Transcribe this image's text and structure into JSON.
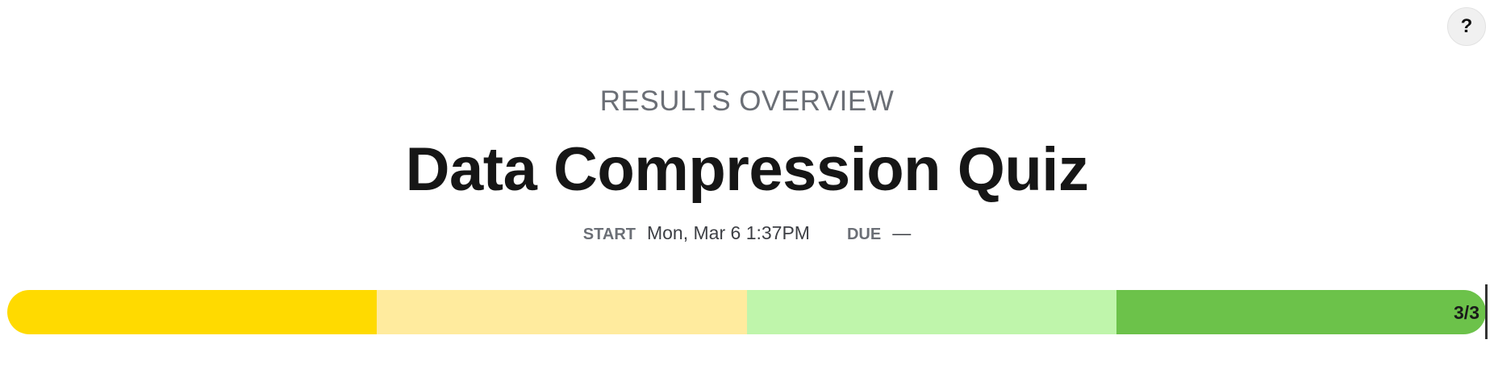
{
  "help": {
    "label": "?"
  },
  "header": {
    "eyebrow": "RESULTS OVERVIEW",
    "title": "Data Compression Quiz"
  },
  "meta": {
    "start_label": "START",
    "start_value": "Mon, Mar 6 1:37PM",
    "due_label": "DUE",
    "due_value": "—"
  },
  "progress": {
    "completed": 3,
    "total": 3,
    "count_text": "3/3",
    "segment_colors": [
      "#ffda00",
      "#ffeb9e",
      "#bff5ab",
      "#6cc24a"
    ]
  }
}
